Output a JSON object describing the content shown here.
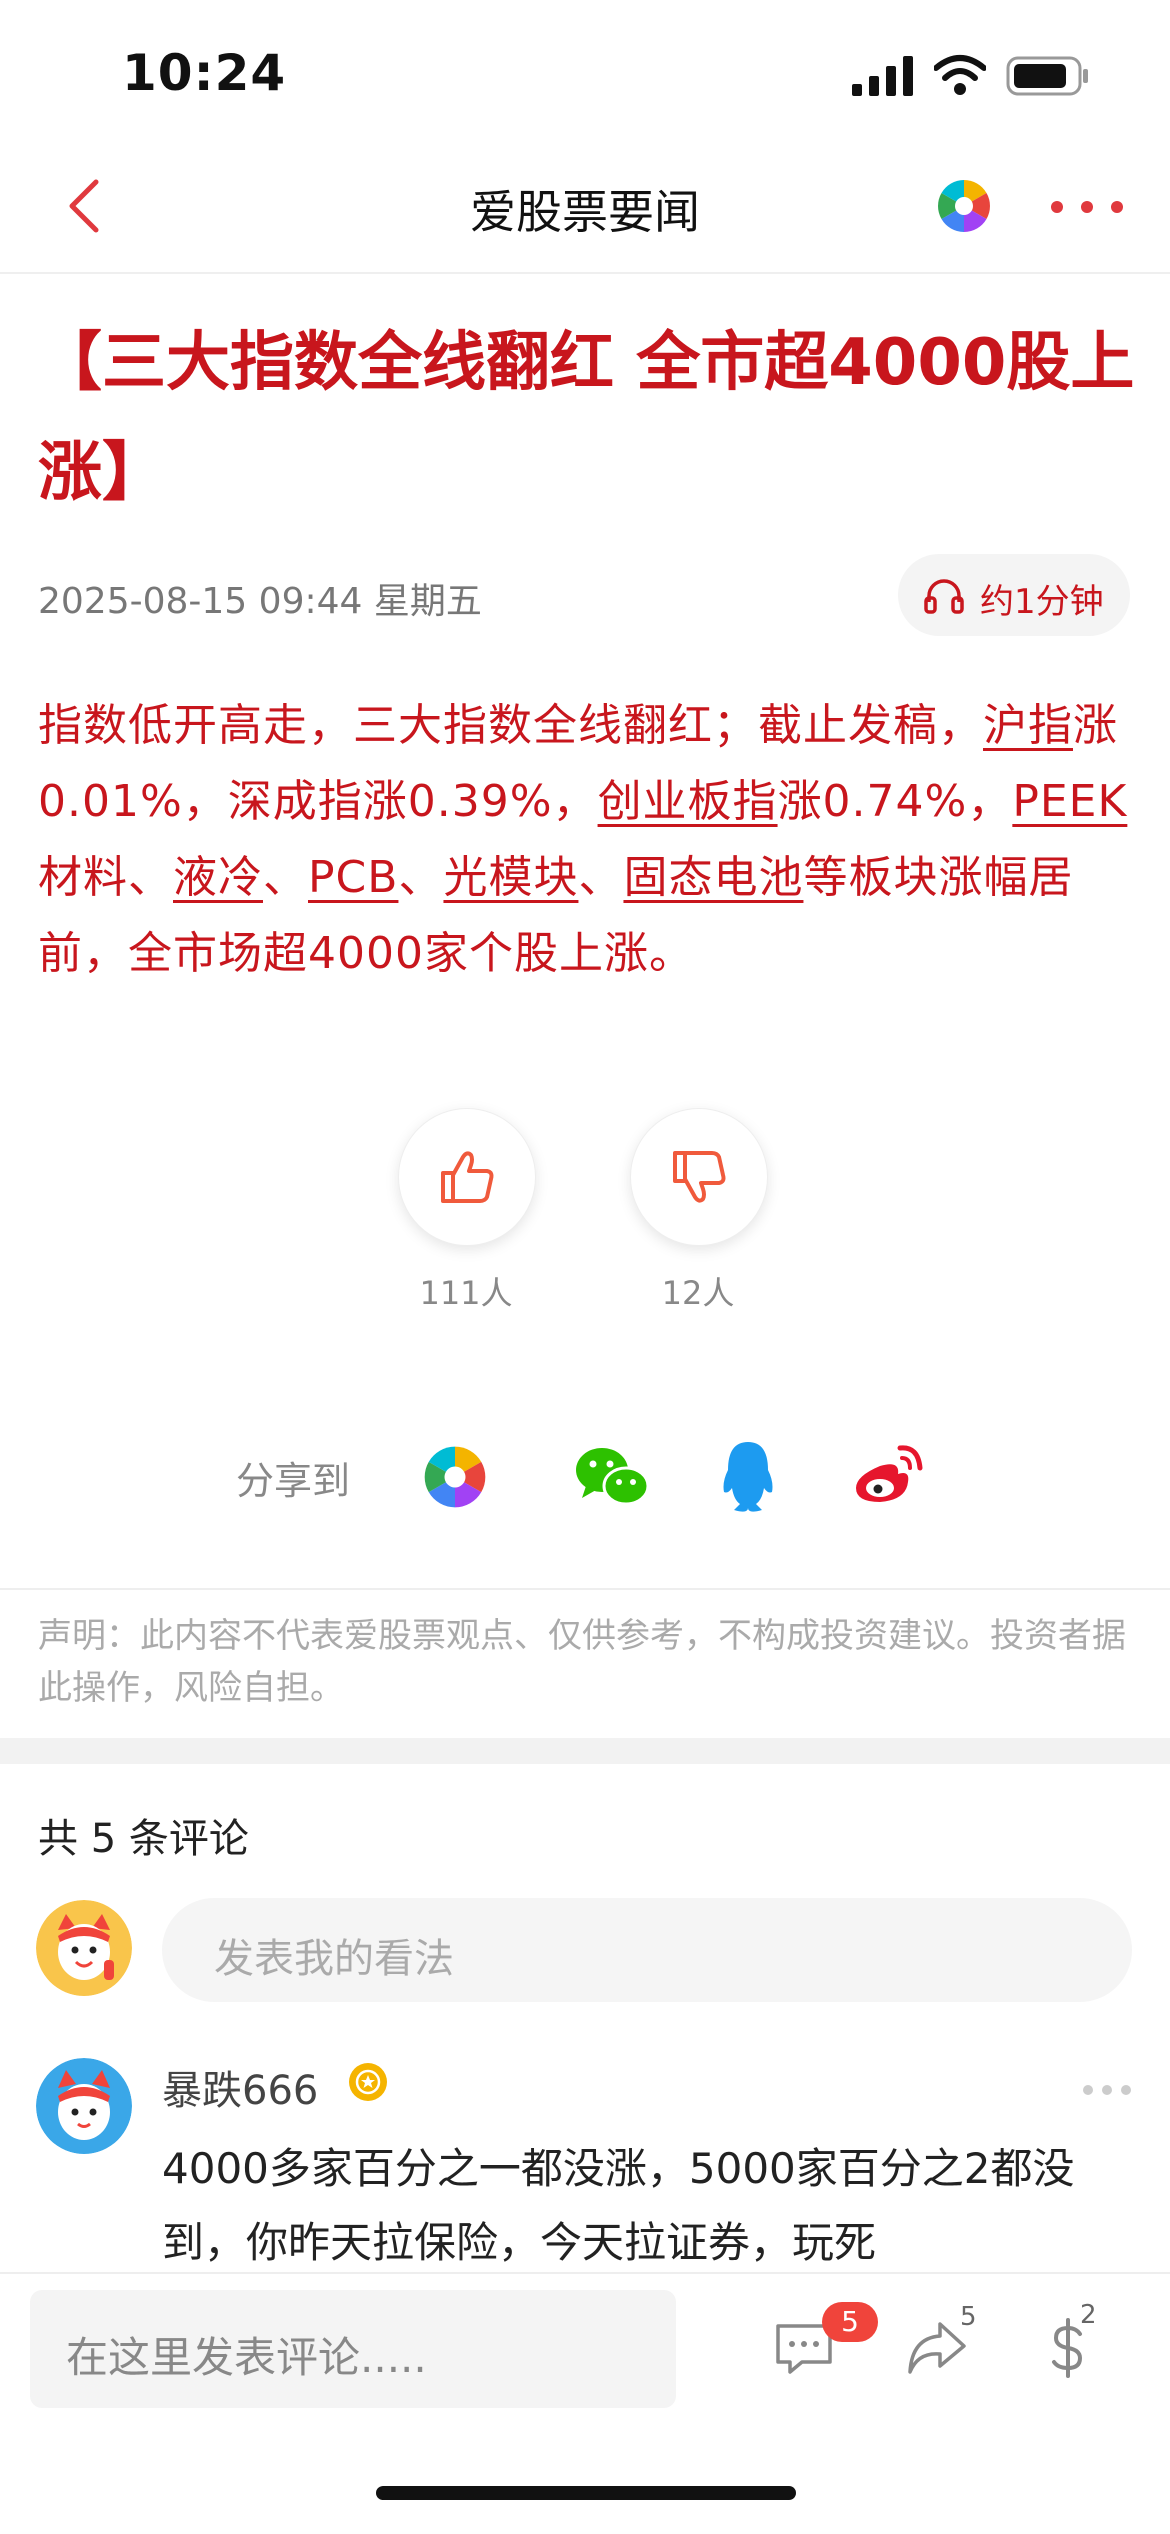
{
  "status": {
    "time": "10:24"
  },
  "nav": {
    "title": "爱股票要闻"
  },
  "article": {
    "headline": "【三大指数全线翻红 全市超4000股上涨】",
    "date": "2025-08-15 09:44 星期五",
    "listen_label": "约1分钟",
    "body": [
      {
        "t": "指数低开高走，三大指数全线翻红；截止发稿，",
        "u": false
      },
      {
        "t": "沪指",
        "u": true
      },
      {
        "t": "涨0.01%，深成指涨0.39%，",
        "u": false
      },
      {
        "t": "创业板指",
        "u": true
      },
      {
        "t": "涨0.74%，",
        "u": false
      },
      {
        "t": "PEEK",
        "u": true
      },
      {
        "t": "材料、",
        "u": false
      },
      {
        "t": "液冷",
        "u": true
      },
      {
        "t": "、",
        "u": false
      },
      {
        "t": "PCB",
        "u": true
      },
      {
        "t": "、",
        "u": false
      },
      {
        "t": "光模块",
        "u": true
      },
      {
        "t": "、",
        "u": false
      },
      {
        "t": "固态电池",
        "u": true
      },
      {
        "t": "等板块涨幅居前，全市场超4000家个股上涨。",
        "u": false
      }
    ]
  },
  "votes": {
    "like_count": "111人",
    "dislike_count": "12人"
  },
  "share": {
    "label": "分享到",
    "targets": [
      "aigupiao-icon",
      "wechat-icon",
      "qq-icon",
      "weibo-icon"
    ]
  },
  "disclaimer": "声明：此内容不代表爱股票观点、仅供参考，不构成投资建议。投资者据此操作，风险自担。",
  "comments": {
    "count_label": "共 5 条评论",
    "input_placeholder": "发表我的看法",
    "items": [
      {
        "user": "暴跌666",
        "text": "4000多家百分之一都没涨，5000家百分之2都没到，你昨天拉保险，今天拉证券，玩死"
      }
    ]
  },
  "bottom": {
    "input_placeholder": "在这里发表评论.....",
    "comment_badge": "5",
    "share_count": "5",
    "reward_count": "2"
  },
  "colors": {
    "accent": "#c8161d",
    "badge": "#f0443b",
    "icon_orange": "#f05a3c"
  }
}
